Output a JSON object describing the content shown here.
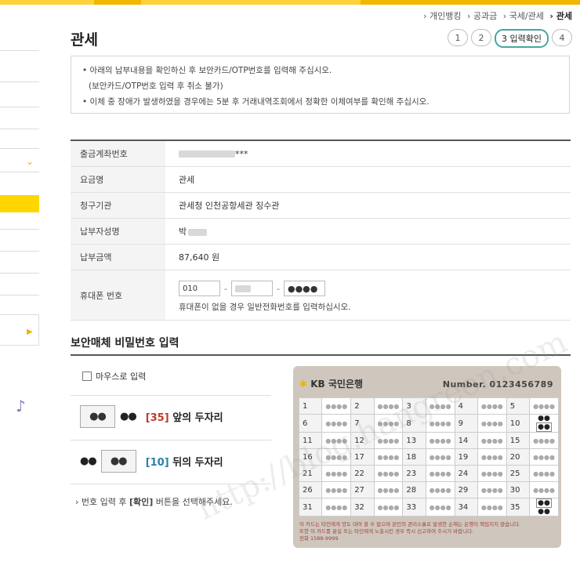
{
  "breadcrumb": [
    "개인뱅킹",
    "공과금",
    "국세/관세",
    "관세"
  ],
  "page_title": "관세",
  "steps": [
    "1",
    "2",
    "3 입력확인",
    "4"
  ],
  "notice": [
    "아래의 납부내용을 확인하신 후 보안카드/OTP번호를 입력해 주십시오.",
    "(보안카드/OTP번호 입력 후 취소 불가)",
    "이체 중 장애가 발생하였을 경우에는 5분 후 거래내역조회에서 정확한 이체여부를 확인해 주십시오."
  ],
  "info": {
    "account_label": "출금계좌번호",
    "account_value": "***",
    "fee_label": "요금명",
    "fee_value": "관세",
    "agency_label": "청구기관",
    "agency_value": "관세청 인천공항세관 징수관",
    "payer_label": "납부자성명",
    "payer_value": "박",
    "amount_label": "납부금액",
    "amount_value": "87,640 원",
    "phone_label": "휴대폰 번호",
    "phone_prefix": "010",
    "phone_last": "●●●●",
    "phone_hint": "휴대폰이 없을 경우 일반전화번호를 입력하십시오."
  },
  "security": {
    "title": "보안매체 비밀번호 입력",
    "mouse_label": "마우스로 입력",
    "front_box": "●●",
    "front_dots": "●●",
    "front_num": "[35]",
    "front_label": "앞의 두자리",
    "back_dots": "●●",
    "back_box": "●●",
    "back_num": "[10]",
    "back_label": "뒤의 두자리",
    "guide_prefix": "› 번호 입력 후 ",
    "guide_bold": "[확인]",
    "guide_suffix": " 버튼을 선택해주세요."
  },
  "card": {
    "bank": "KB 국민은행",
    "number": "Number. 0123456789",
    "masked": "●●●●",
    "cell10": "●●",
    "cell10_box": "●●",
    "cell35_box": "●●",
    "cell35": "●●",
    "foot1": "이 카드는 타인에게 양도 대여 할 수 없으며 본인의 관리소홀로 발생한 손해는 은행이 책임지지 않습니다.",
    "foot2": "또한 이 카드를 분실 또는 타인에게 노출시킨 경우 즉시 신고하여 주시기 바랍니다.",
    "foot3": "전화 1588-9999"
  },
  "watermark": "http://blog.hangreen.com"
}
